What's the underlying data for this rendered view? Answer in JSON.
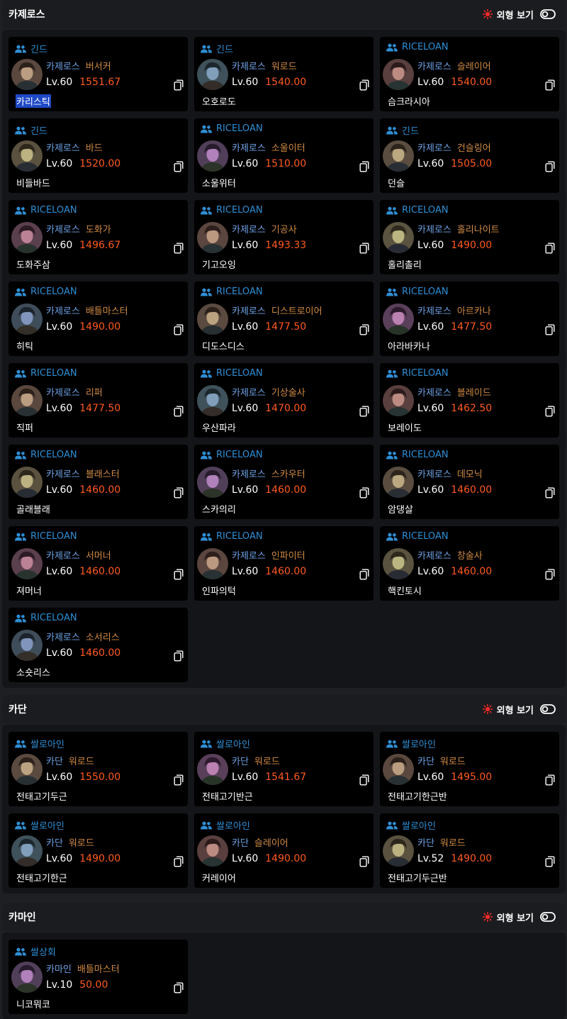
{
  "toggle_label": "외형 보기",
  "colors": {
    "guild": "#2f8fd6",
    "server": "#6ea2e6",
    "class": "#d08a44",
    "item_level": "#ff5a1f",
    "toggle_sun": "#ff2a2a"
  },
  "icons": {
    "guild": "people-icon",
    "toggle": "sun-icon",
    "switch": "toggle-switch-icon",
    "copy": "copy-icon"
  },
  "sections": [
    {
      "title": "카제로스",
      "cards": [
        {
          "guild": "긴드",
          "server": "카제로스",
          "class": "버서커",
          "level": "Lv.60",
          "item_level": "1551.67",
          "name": "카리스틱",
          "selected": true
        },
        {
          "guild": "긴드",
          "server": "카제로스",
          "class": "워로드",
          "level": "Lv.60",
          "item_level": "1540.00",
          "name": "오호로도"
        },
        {
          "guild": "RICELOAN",
          "server": "카제로스",
          "class": "슬레이어",
          "level": "Lv.60",
          "item_level": "1540.00",
          "name": "슴크라시아"
        },
        {
          "guild": "긴드",
          "server": "카제로스",
          "class": "바드",
          "level": "Lv.60",
          "item_level": "1520.00",
          "name": "비들바드"
        },
        {
          "guild": "RICELOAN",
          "server": "카제로스",
          "class": "소울이터",
          "level": "Lv.60",
          "item_level": "1510.00",
          "name": "소울위터"
        },
        {
          "guild": "긴드",
          "server": "카제로스",
          "class": "건슬링어",
          "level": "Lv.60",
          "item_level": "1505.00",
          "name": "던슬"
        },
        {
          "guild": "RICELOAN",
          "server": "카제로스",
          "class": "도화가",
          "level": "Lv.60",
          "item_level": "1496.67",
          "name": "도화주삼"
        },
        {
          "guild": "RICELOAN",
          "server": "카제로스",
          "class": "기공사",
          "level": "Lv.60",
          "item_level": "1493.33",
          "name": "기고오잉"
        },
        {
          "guild": "RICELOAN",
          "server": "카제로스",
          "class": "홀리나이트",
          "level": "Lv.60",
          "item_level": "1490.00",
          "name": "홀리촐리"
        },
        {
          "guild": "RICELOAN",
          "server": "카제로스",
          "class": "배틀마스터",
          "level": "Lv.60",
          "item_level": "1490.00",
          "name": "히틱"
        },
        {
          "guild": "RICELOAN",
          "server": "카제로스",
          "class": "디스트로이어",
          "level": "Lv.60",
          "item_level": "1477.50",
          "name": "디도스디스"
        },
        {
          "guild": "RICELOAN",
          "server": "카제로스",
          "class": "아르카나",
          "level": "Lv.60",
          "item_level": "1477.50",
          "name": "아라바카나"
        },
        {
          "guild": "RICELOAN",
          "server": "카제로스",
          "class": "리퍼",
          "level": "Lv.60",
          "item_level": "1477.50",
          "name": "직퍼"
        },
        {
          "guild": "RICELOAN",
          "server": "카제로스",
          "class": "기상술사",
          "level": "Lv.60",
          "item_level": "1470.00",
          "name": "우산파라"
        },
        {
          "guild": "RICELOAN",
          "server": "카제로스",
          "class": "블레이드",
          "level": "Lv.60",
          "item_level": "1462.50",
          "name": "보레이도"
        },
        {
          "guild": "RICELOAN",
          "server": "카제로스",
          "class": "블래스터",
          "level": "Lv.60",
          "item_level": "1460.00",
          "name": "골래블래"
        },
        {
          "guild": "RICELOAN",
          "server": "카제로스",
          "class": "스카우터",
          "level": "Lv.60",
          "item_level": "1460.00",
          "name": "스카의리"
        },
        {
          "guild": "RICELOAN",
          "server": "카제로스",
          "class": "데모닉",
          "level": "Lv.60",
          "item_level": "1460.00",
          "name": "암댕살"
        },
        {
          "guild": "RICELOAN",
          "server": "카제로스",
          "class": "서머너",
          "level": "Lv.60",
          "item_level": "1460.00",
          "name": "져머너"
        },
        {
          "guild": "RICELOAN",
          "server": "카제로스",
          "class": "인파이터",
          "level": "Lv.60",
          "item_level": "1460.00",
          "name": "인파의턱"
        },
        {
          "guild": "RICELOAN",
          "server": "카제로스",
          "class": "창술사",
          "level": "Lv.60",
          "item_level": "1460.00",
          "name": "핵킨토시"
        },
        {
          "guild": "RICELOAN",
          "server": "카제로스",
          "class": "소서리스",
          "level": "Lv.60",
          "item_level": "1460.00",
          "name": "소숏리스"
        }
      ]
    },
    {
      "title": "카단",
      "cards": [
        {
          "guild": "쌀로아인",
          "server": "카단",
          "class": "워로드",
          "level": "Lv.60",
          "item_level": "1550.00",
          "name": "전태고기두근"
        },
        {
          "guild": "쌀로아인",
          "server": "카단",
          "class": "워로드",
          "level": "Lv.60",
          "item_level": "1541.67",
          "name": "전태고기반근"
        },
        {
          "guild": "쌀로아인",
          "server": "카단",
          "class": "워로드",
          "level": "Lv.60",
          "item_level": "1495.00",
          "name": "전태고기한근반"
        },
        {
          "guild": "쌀로아인",
          "server": "카단",
          "class": "워로드",
          "level": "Lv.60",
          "item_level": "1490.00",
          "name": "전태고기한근"
        },
        {
          "guild": "쌀로아인",
          "server": "카단",
          "class": "슬레이어",
          "level": "Lv.60",
          "item_level": "1490.00",
          "name": "커레이어"
        },
        {
          "guild": "쌀로아인",
          "server": "카단",
          "class": "워로드",
          "level": "Lv.52",
          "item_level": "1490.00",
          "name": "전태고기두근반"
        }
      ]
    },
    {
      "title": "카마인",
      "cards": [
        {
          "guild": "쌀상회",
          "server": "카마인",
          "class": "배틀마스터",
          "level": "Lv.10",
          "item_level": "50.00",
          "name": "니코뭐코"
        }
      ]
    }
  ]
}
